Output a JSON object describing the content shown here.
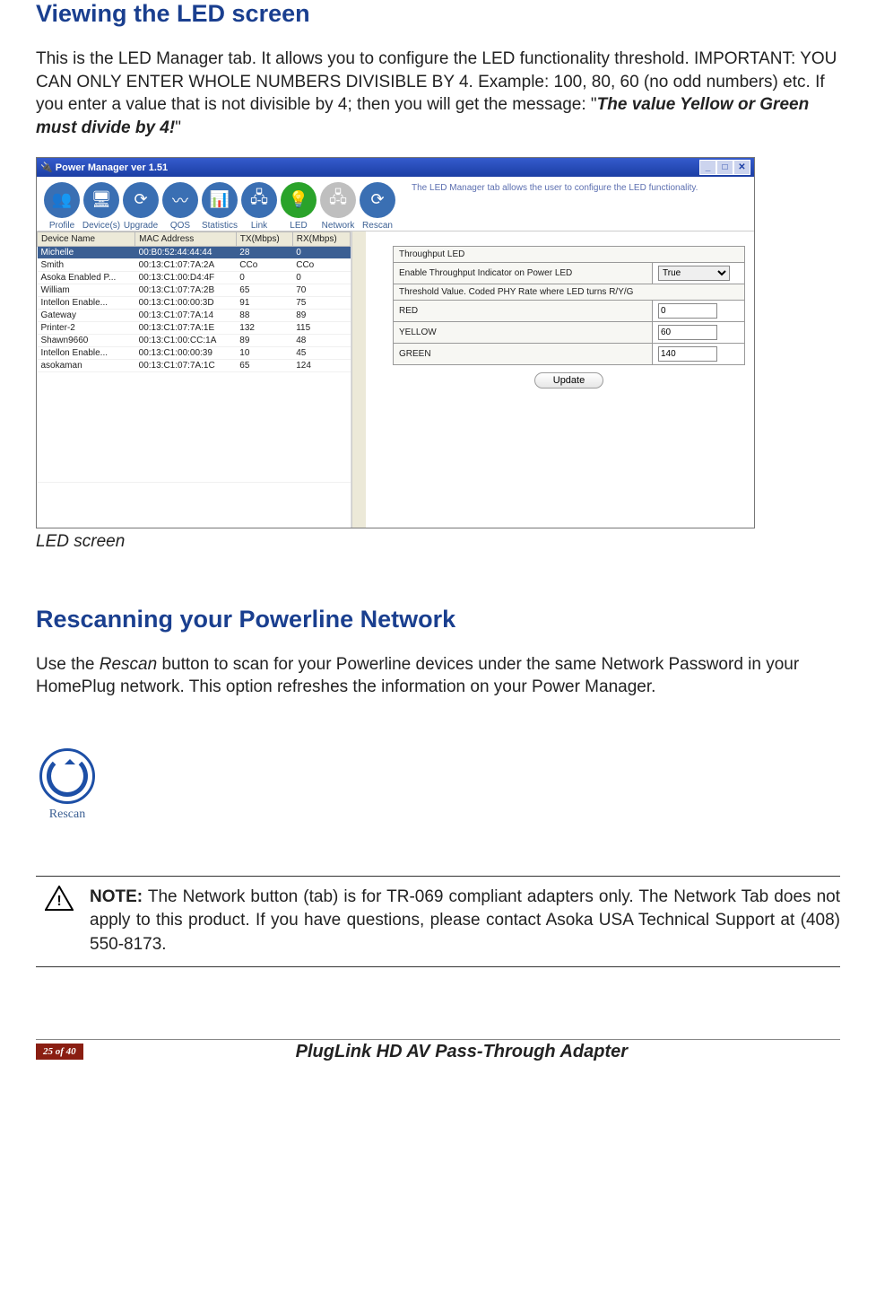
{
  "section1_title": "Viewing the LED screen",
  "section1_para_a": "This is the LED Manager tab. It allows you to configure the LED functionality threshold. IMPORTANT: YOU CAN ONLY ENTER WHOLE NUMBERS DIVISIBLE BY 4. Example: 100, 80, 60 (no odd numbers) etc. If you enter a value that is not divisible by 4; then you will get the message: \"",
  "section1_para_bold": "The value Yellow or Green must divide by 4!",
  "section1_para_b": "\"",
  "caption": "LED screen",
  "window": {
    "title": "Power Manager ver 1.51",
    "hint": "The LED Manager tab allows the user to configure the LED functionality.",
    "tabs": [
      {
        "label": "Profile",
        "icon": "👥"
      },
      {
        "label": "Device(s)",
        "icon": "🖥"
      },
      {
        "label": "Upgrade",
        "icon": "⟳"
      },
      {
        "label": "QOS",
        "icon": "〰"
      },
      {
        "label": "Statistics",
        "icon": "📊"
      },
      {
        "label": "Link",
        "icon": "🖧"
      },
      {
        "label": "LED",
        "icon": "💡"
      },
      {
        "label": "Network",
        "icon": "🖧"
      },
      {
        "label": "Rescan",
        "icon": "⟳"
      }
    ],
    "cols": [
      "Device Name",
      "MAC Address",
      "TX(Mbps)",
      "RX(Mbps)"
    ],
    "rows": [
      [
        "Michelle",
        "00:B0:52:44:44:44",
        "28",
        "0"
      ],
      [
        "Smith",
        "00:13:C1:07:7A:2A",
        "CCo",
        "CCo"
      ],
      [
        "Asoka Enabled P...",
        "00:13:C1:00:D4:4F",
        "0",
        "0"
      ],
      [
        "William",
        "00:13:C1:07:7A:2B",
        "65",
        "70"
      ],
      [
        "Intellon Enable...",
        "00:13:C1:00:00:3D",
        "91",
        "75"
      ],
      [
        "Gateway",
        "00:13:C1:07:7A:14",
        "88",
        "89"
      ],
      [
        "Printer-2",
        "00:13:C1:07:7A:1E",
        "132",
        "115"
      ],
      [
        "Shawn9660",
        "00:13:C1:00:CC:1A",
        "89",
        "48"
      ],
      [
        "Intellon Enable...",
        "00:13:C1:00:00:39",
        "10",
        "45"
      ],
      [
        "asokaman",
        "00:13:C1:07:7A:1C",
        "65",
        "124"
      ]
    ],
    "cfg": {
      "h1": "Throughput LED",
      "h2": "Enable Throughput Indicator on Power LED",
      "h2v": "True",
      "h3": "Threshold Value. Coded PHY Rate where LED turns R/Y/G",
      "red_l": "RED",
      "red_v": "0",
      "yel_l": "YELLOW",
      "yel_v": "60",
      "grn_l": "GREEN",
      "grn_v": "140",
      "update": "Update"
    }
  },
  "section2_title": "Rescanning your Powerline Network",
  "section2_para_a": "Use the ",
  "section2_para_i": "Rescan",
  "section2_para_b": " button to scan for your Powerline devices under the same Network Password in your HomePlug network.  This option refreshes the information on your Power Manager.",
  "rescan_label": "Rescan",
  "note_bold": "NOTE:",
  "note_text": "  The Network button (tab) is for TR-069 compliant adapters only. The Network Tab does not apply to this product. If you have questions, please contact Asoka USA Technical Support at (408) 550-8173.",
  "page_of": "25 of 40",
  "product": "PlugLink HD AV Pass-Through Adapter"
}
